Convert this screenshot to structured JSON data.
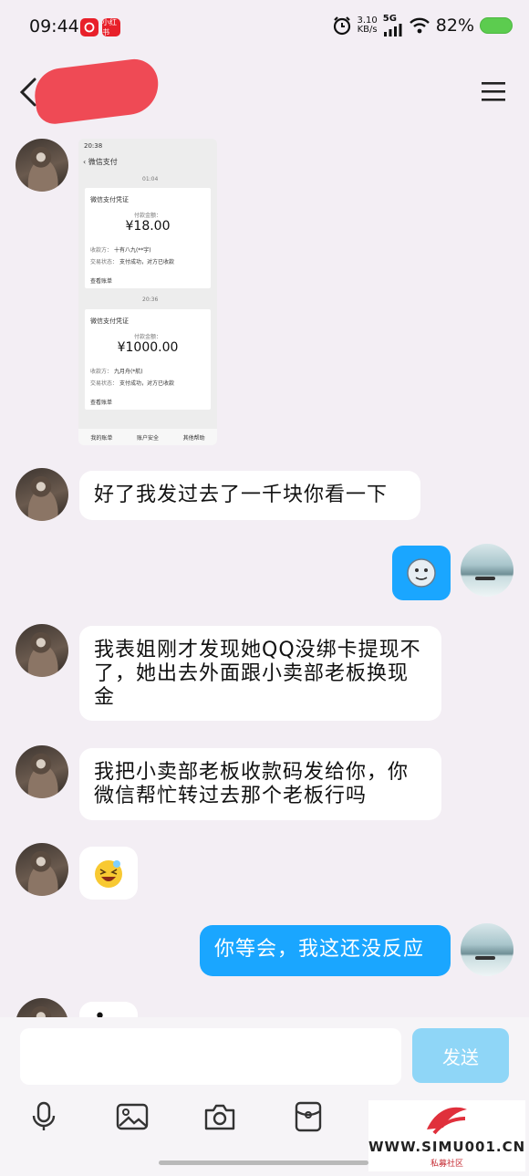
{
  "status_bar": {
    "time": "09:44",
    "badge_1": "",
    "badge_2": "小红书",
    "net_speed_value": "3.10",
    "net_speed_unit": "KB/s",
    "network": "5G",
    "battery": "82%"
  },
  "header": {
    "contact_name": ""
  },
  "screenshot_image": {
    "time": "20:38",
    "title": "微信支付",
    "time_1": "01:04",
    "card_title_1": "微信支付凭证",
    "amount_label_1": "付款金额：",
    "amount_1": "¥18.00",
    "payee_label_1": "收款方：",
    "payee_1": "十有八九(**宇)",
    "status_label_1": "交易状态：",
    "status_1": "支付成功，对方已收款",
    "view_bill_1": "查看账单",
    "time_2": "20:36",
    "card_title_2": "微信支付凭证",
    "amount_label_2": "付款金额：",
    "amount_2": "¥1000.00",
    "payee_label_2": "收款方：",
    "payee_2": "九月舟(*航)",
    "status_label_2": "交易状态：",
    "status_2": "支付成功，对方已收款",
    "view_bill_2": "查看账单",
    "bottom_menu": [
      "我的账单",
      "账户安全",
      "其他帮助"
    ]
  },
  "messages": {
    "m1": "好了我发过去了一千块你看一下",
    "m3": "我表姐刚才发现她QQ没绑卡提现不了，她出去外面跟小卖部老板换现金",
    "m4": "我把小卖部老板收款码发给你，你微信帮忙转过去那个老板行吗",
    "m6": "你等会，我这还没反应",
    "m7_partial": "•"
  },
  "input": {
    "placeholder": "",
    "send_label": "发送"
  },
  "toolbar": [
    "microphone-icon",
    "image-icon",
    "camera-icon",
    "red-packet-icon"
  ],
  "watermark": {
    "text": "WWW.SIMU001.CN",
    "sub": "私募社区"
  }
}
